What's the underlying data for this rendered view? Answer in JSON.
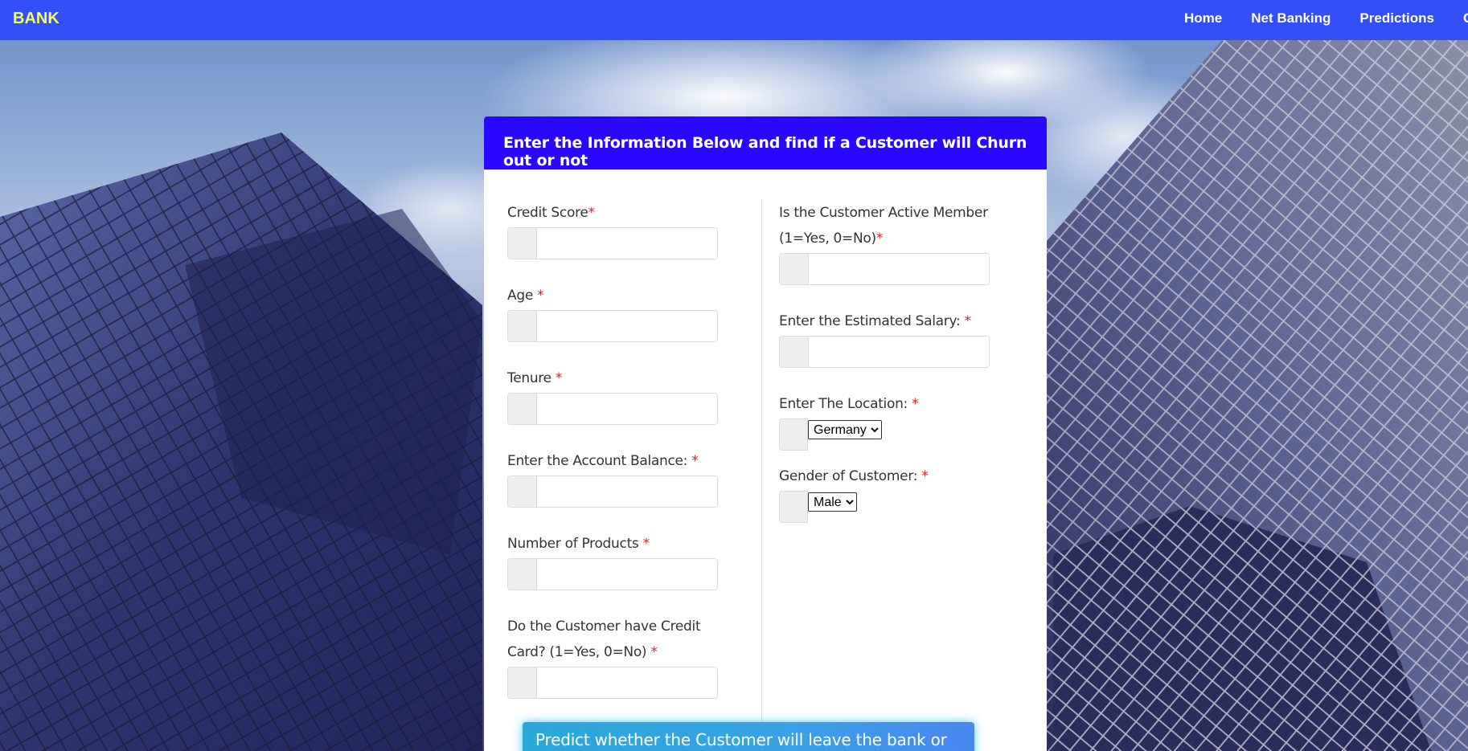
{
  "navbar": {
    "brand": "BANK",
    "links": [
      "Home",
      "Net Banking",
      "Predictions",
      "Co"
    ]
  },
  "form": {
    "title": "Enter the Information Below and find if a Customer will Churn out or not",
    "required_mark": "*",
    "left_fields": [
      {
        "label": "Credit Score",
        "value": ""
      },
      {
        "label": "Age ",
        "value": ""
      },
      {
        "label": "Tenure ",
        "value": ""
      },
      {
        "label": "Enter the Account Balance: ",
        "value": ""
      },
      {
        "label": "Number of Products ",
        "value": ""
      },
      {
        "label": "Do the Customer have Credit Card? (1=Yes, 0=No) ",
        "value": ""
      }
    ],
    "right_fields": [
      {
        "label": "Is the Customer Active Member (1=Yes, 0=No)",
        "value": ""
      },
      {
        "label": "Enter the Estimated Salary: ",
        "value": ""
      }
    ],
    "location": {
      "label": "Enter The Location: ",
      "selected": "Germany"
    },
    "gender": {
      "label": "Gender of Customer: ",
      "selected": "Male"
    },
    "submit_label": "Predict whether the Customer will leave the bank or not?"
  },
  "colors": {
    "navbar": "#3350f8",
    "brand": "#f5ff5a",
    "card_header": "#2a08ff",
    "required": "#e02020",
    "button": "#3aa2e6"
  }
}
